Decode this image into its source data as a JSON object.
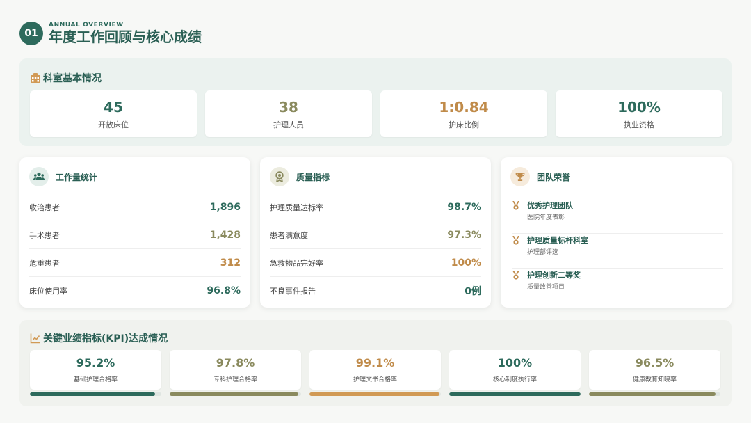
{
  "header": {
    "number": "01",
    "subtitle": "ANNUAL OVERVIEW",
    "title": "年度工作回顾与核心成绩"
  },
  "basic": {
    "title": "科室基本情况",
    "icon": "hospital-icon",
    "stats": [
      {
        "value": "45",
        "label": "开放床位",
        "color": "#2d6a5c"
      },
      {
        "value": "38",
        "label": "护理人员",
        "color": "#8a8a5e"
      },
      {
        "value": "1:0.84",
        "label": "护床比例",
        "color": "#c08b4a"
      },
      {
        "value": "100%",
        "label": "执业资格",
        "color": "#2d6a5c"
      }
    ]
  },
  "workload": {
    "title": "工作量统计",
    "icon": "people-icon",
    "rows": [
      {
        "label": "收治患者",
        "value": "1,896",
        "color": "#2d6a5c"
      },
      {
        "label": "手术患者",
        "value": "1,428",
        "color": "#8a8a5e"
      },
      {
        "label": "危重患者",
        "value": "312",
        "color": "#c08b4a"
      },
      {
        "label": "床位使用率",
        "value": "96.8%",
        "color": "#2d6a5c"
      }
    ]
  },
  "quality": {
    "title": "质量指标",
    "icon": "award-icon",
    "rows": [
      {
        "label": "护理质量达标率",
        "value": "98.7%",
        "color": "#2d6a5c"
      },
      {
        "label": "患者满意度",
        "value": "97.3%",
        "color": "#8a8a5e"
      },
      {
        "label": "急救物品完好率",
        "value": "100%",
        "color": "#c08b4a"
      },
      {
        "label": "不良事件报告",
        "value": "0例",
        "color": "#2d6a5c"
      }
    ]
  },
  "honor": {
    "title": "团队荣誉",
    "icon": "trophy-icon",
    "items": [
      {
        "name": "优秀护理团队",
        "desc": "医院年度表彰"
      },
      {
        "name": "护理质量标杆科室",
        "desc": "护理部评选"
      },
      {
        "name": "护理创新二等奖",
        "desc": "质量改善项目"
      }
    ]
  },
  "kpi": {
    "title": "关键业绩指标(KPI)达成情况",
    "icon": "chart-line-icon",
    "items": [
      {
        "value": "95.2%",
        "label": "基础护理合格率",
        "progress": 0.952,
        "color": "#2d6a5c",
        "bar": "#2d6a5c"
      },
      {
        "value": "97.8%",
        "label": "专科护理合格率",
        "progress": 0.978,
        "color": "#8a8a5e",
        "bar": "#8a8a5e"
      },
      {
        "value": "99.1%",
        "label": "护理文书合格率",
        "progress": 0.991,
        "color": "#c08b4a",
        "bar": "#d19a55"
      },
      {
        "value": "100%",
        "label": "核心制度执行率",
        "progress": 1.0,
        "color": "#2d6a5c",
        "bar": "#2d6a5c"
      },
      {
        "value": "96.5%",
        "label": "健康教育知晓率",
        "progress": 0.965,
        "color": "#8a8a5e",
        "bar": "#8a8a5e"
      }
    ]
  }
}
